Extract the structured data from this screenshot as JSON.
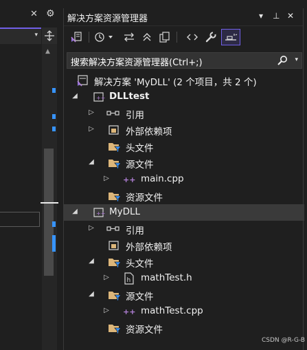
{
  "left": {
    "close_glyph": "✕",
    "settings_glyph": "⚙",
    "dropdown_chevron": "▾",
    "scroll_up": "▲"
  },
  "explorer": {
    "title": "解决方案资源管理器",
    "title_buttons": {
      "dropdown": "▾",
      "pin": "⊥",
      "close": "✕"
    },
    "toolbar_icons": [
      "switch-views-icon",
      "history-icon",
      "sync-icon",
      "collapse-all-icon",
      "show-all-files-icon",
      "view-code-icon",
      "properties-icon",
      "preview-icon"
    ],
    "search_placeholder": "搜索解决方案资源管理器(Ctrl+;)",
    "tree": [
      {
        "label": "解决方案 'MyDLL' (2 个项目，共 2 个)",
        "icon": "solution-icon"
      },
      {
        "label": "DLLtest",
        "icon": "cpp-project-icon",
        "expander": "◢"
      },
      {
        "label": "引用",
        "icon": "references-icon",
        "expander": "▷"
      },
      {
        "label": "外部依赖项",
        "icon": "external-deps-icon",
        "expander": "▷"
      },
      {
        "label": "头文件",
        "icon": "filter-folder-icon"
      },
      {
        "label": "源文件",
        "icon": "filter-folder-icon",
        "expander": "◢"
      },
      {
        "label": "main.cpp",
        "icon": "cpp-file-icon",
        "expander": "▷"
      },
      {
        "label": "资源文件",
        "icon": "filter-folder-icon"
      },
      {
        "label": "MyDLL",
        "icon": "cpp-project-icon",
        "expander": "◢"
      },
      {
        "label": "引用",
        "icon": "references-icon",
        "expander": "▷"
      },
      {
        "label": "外部依赖项",
        "icon": "external-deps-icon"
      },
      {
        "label": "头文件",
        "icon": "filter-folder-icon",
        "expander": "◢"
      },
      {
        "label": "mathTest.h",
        "icon": "header-file-icon",
        "expander": "▷"
      },
      {
        "label": "源文件",
        "icon": "filter-folder-icon",
        "expander": "◢"
      },
      {
        "label": "mathTest.cpp",
        "icon": "cpp-file-icon",
        "expander": "▷"
      },
      {
        "label": "资源文件",
        "icon": "filter-folder-icon"
      }
    ],
    "selected_index": 8
  },
  "watermark": "CSDN @R-G-B",
  "colors": {
    "accent": "#7160e8",
    "background": "#1f1f1f",
    "folder": "#dcb67a",
    "cpp": "#b180d7",
    "selection": "#3a3a3a",
    "marker": "#3794ff"
  }
}
